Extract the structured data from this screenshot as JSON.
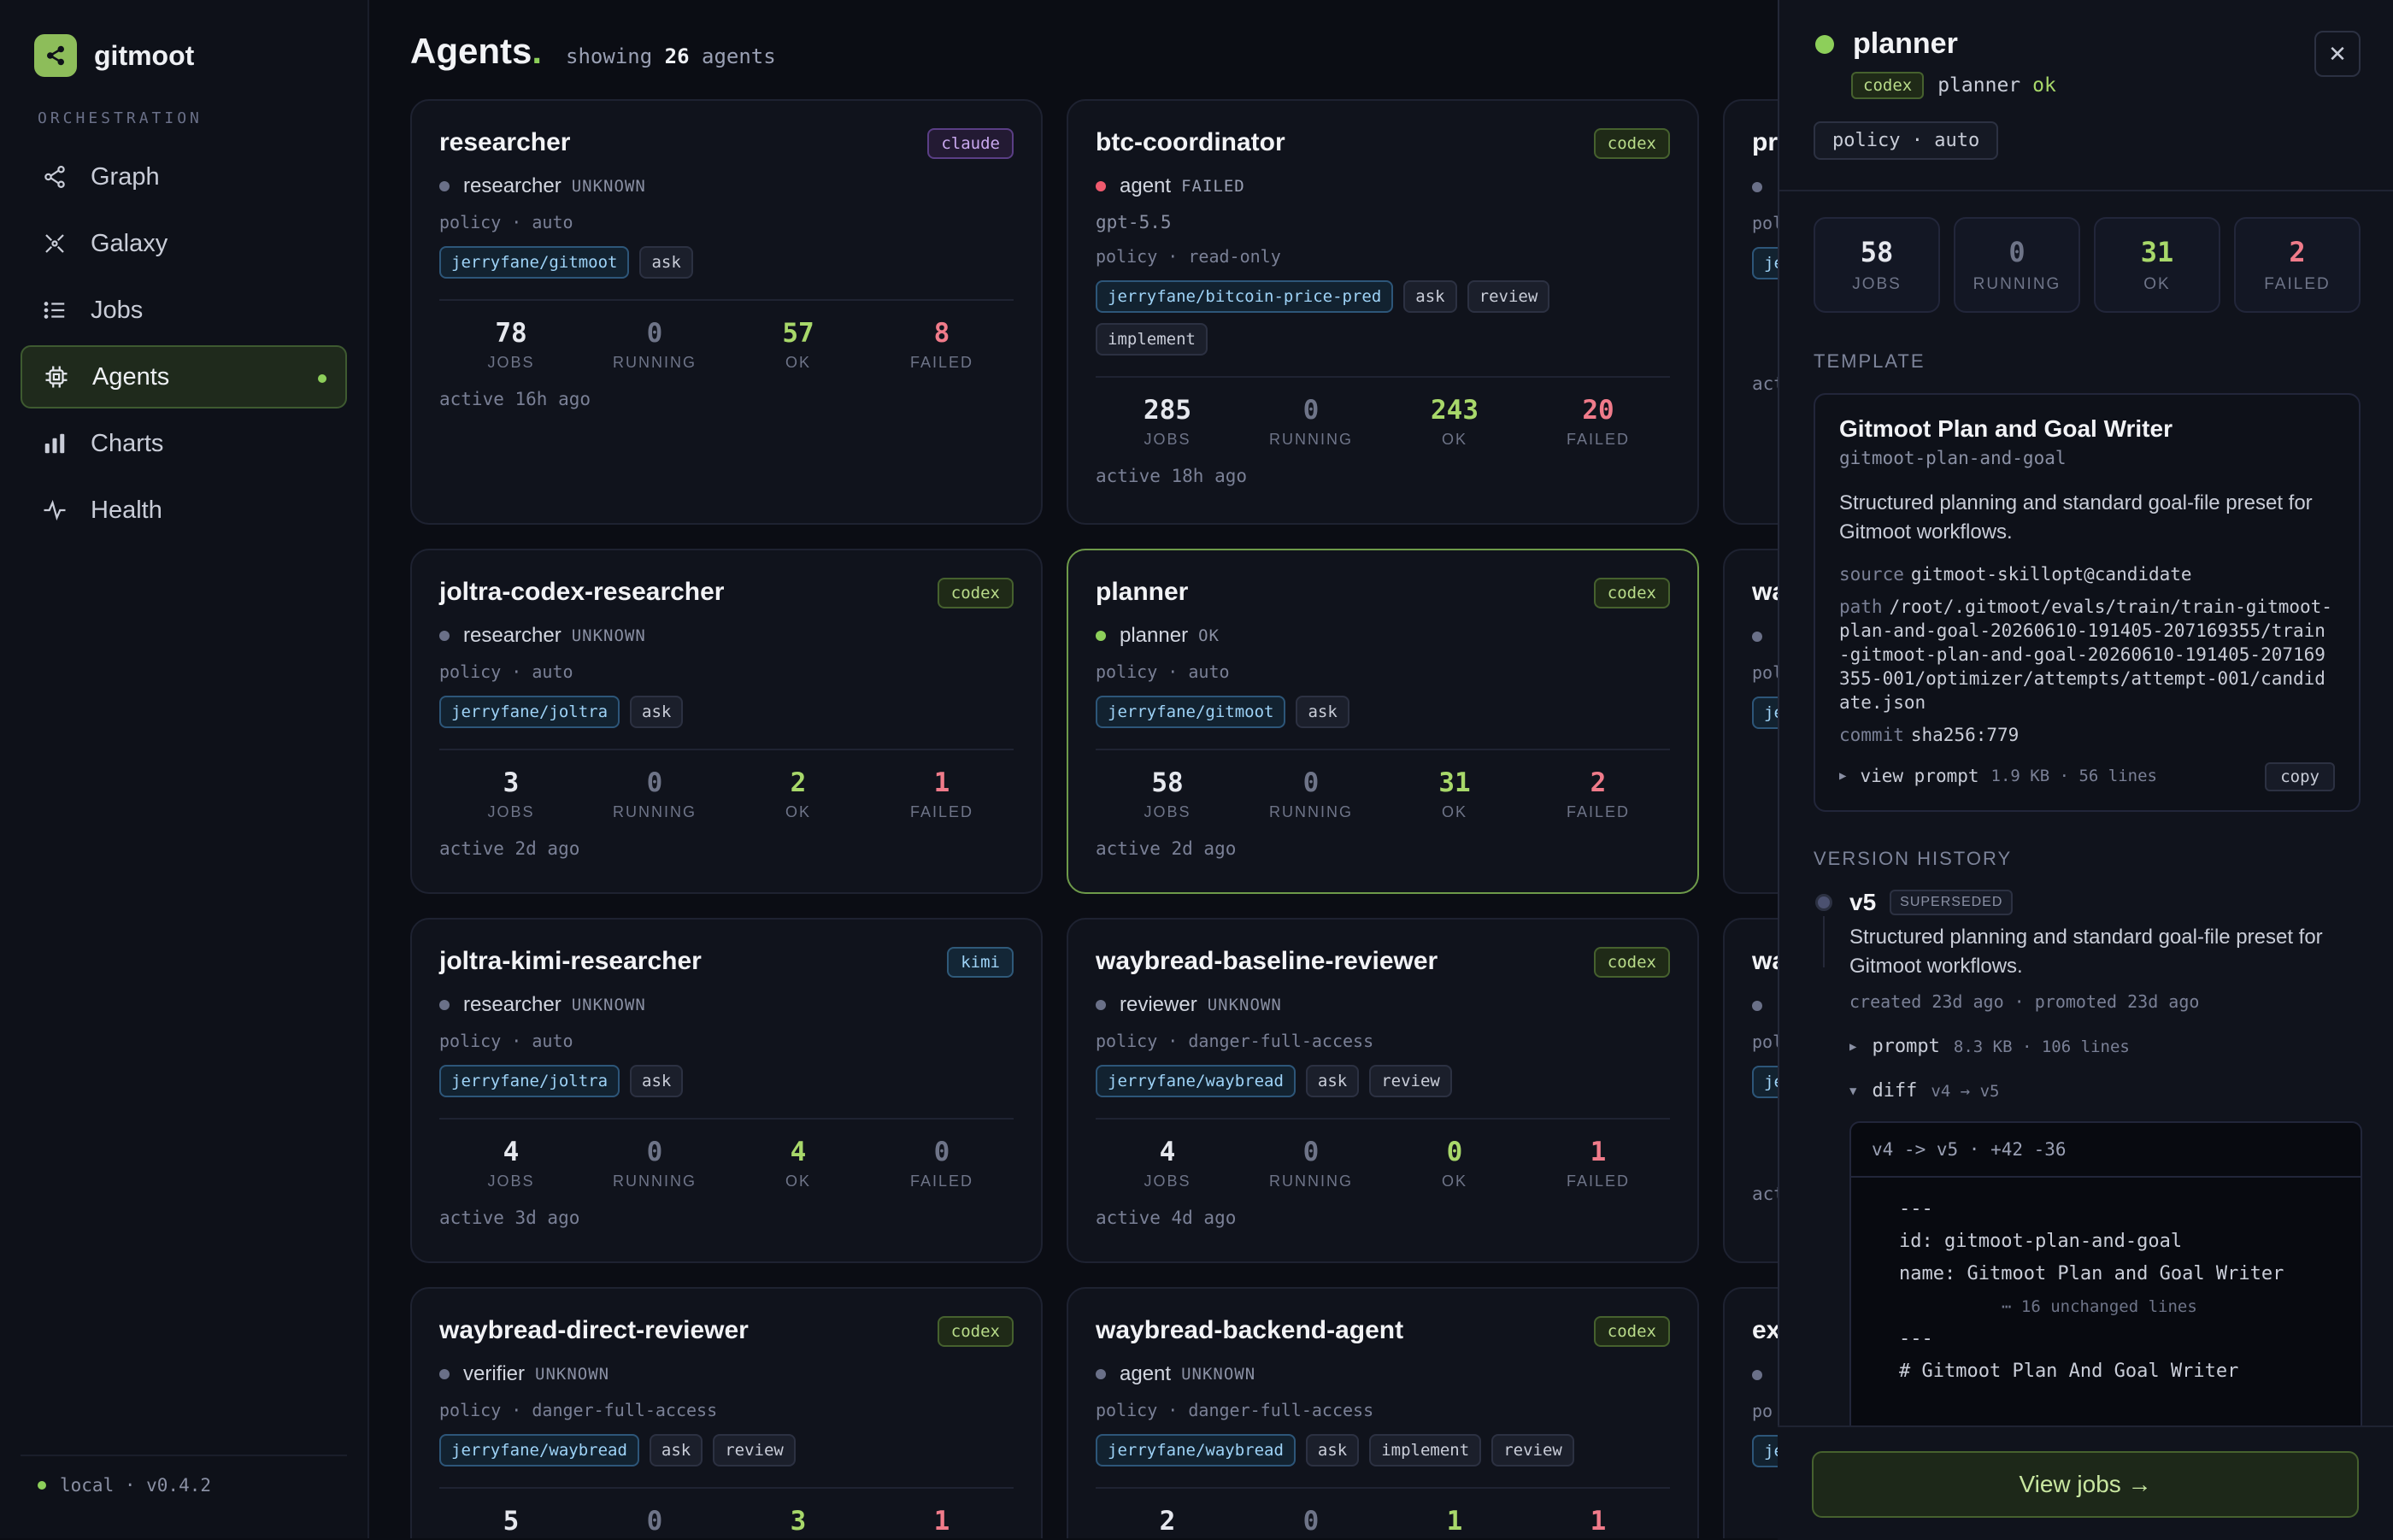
{
  "app": {
    "name": "gitmoot",
    "version_label": "local · v0.4.2"
  },
  "sidebar": {
    "section": "ORCHESTRATION",
    "items": [
      {
        "label": "Graph",
        "icon": "graph-icon",
        "active": false
      },
      {
        "label": "Galaxy",
        "icon": "galaxy-icon",
        "active": false
      },
      {
        "label": "Jobs",
        "icon": "list-icon",
        "active": false
      },
      {
        "label": "Agents",
        "icon": "chip-icon",
        "active": true
      },
      {
        "label": "Charts",
        "icon": "bar-chart-icon",
        "active": false
      },
      {
        "label": "Health",
        "icon": "pulse-icon",
        "active": false
      }
    ]
  },
  "header": {
    "title": "Agents",
    "showing_prefix": "showing",
    "count": "26",
    "showing_suffix": "agents"
  },
  "stat_labels": {
    "jobs": "JOBS",
    "running": "RUNNING",
    "ok": "OK",
    "failed": "FAILED"
  },
  "agents": [
    {
      "name": "researcher",
      "provider": "claude",
      "role": "researcher",
      "status": "UNKNOWN",
      "model": "",
      "policy": "policy · auto",
      "tags": [
        "jerryfane/gitmoot",
        "ask"
      ],
      "jobs": "78",
      "running": "0",
      "ok": "57",
      "failed": "8",
      "active": "active 16h ago"
    },
    {
      "name": "btc-coordinator",
      "provider": "codex",
      "role": "agent",
      "status": "FAILED",
      "model": "gpt-5.5",
      "policy": "policy · read-only",
      "tags": [
        "jerryfane/bitcoin-price-pred",
        "ask",
        "review",
        "implement"
      ],
      "jobs": "285",
      "running": "0",
      "ok": "243",
      "failed": "20",
      "active": "active 18h ago"
    },
    {
      "name": "pr",
      "provider": "",
      "role": "",
      "status": "",
      "model": "",
      "policy": "pol",
      "tags": [
        "je"
      ],
      "jobs": "",
      "running": "",
      "ok": "",
      "failed": "",
      "active": "act"
    },
    {
      "name": "joltra-codex-researcher",
      "provider": "codex",
      "role": "researcher",
      "status": "UNKNOWN",
      "model": "",
      "policy": "policy · auto",
      "tags": [
        "jerryfane/joltra",
        "ask"
      ],
      "jobs": "3",
      "running": "0",
      "ok": "2",
      "failed": "1",
      "active": "active 2d ago"
    },
    {
      "name": "planner",
      "provider": "codex",
      "role": "planner",
      "status": "OK",
      "model": "",
      "policy": "policy · auto",
      "tags": [
        "jerryfane/gitmoot",
        "ask"
      ],
      "jobs": "58",
      "running": "0",
      "ok": "31",
      "failed": "2",
      "active": "active 2d ago"
    },
    {
      "name": "wa",
      "provider": "",
      "role": "",
      "status": "",
      "model": "",
      "policy": "pol",
      "tags": [
        "je"
      ],
      "jobs": "",
      "running": "",
      "ok": "",
      "failed": "",
      "active": ""
    },
    {
      "name": "joltra-kimi-researcher",
      "provider": "kimi",
      "role": "researcher",
      "status": "UNKNOWN",
      "model": "",
      "policy": "policy · auto",
      "tags": [
        "jerryfane/joltra",
        "ask"
      ],
      "jobs": "4",
      "running": "0",
      "ok": "4",
      "failed": "0",
      "active": "active 3d ago"
    },
    {
      "name": "waybread-baseline-reviewer",
      "provider": "codex",
      "role": "reviewer",
      "status": "UNKNOWN",
      "model": "",
      "policy": "policy · danger-full-access",
      "tags": [
        "jerryfane/waybread",
        "ask",
        "review"
      ],
      "jobs": "4",
      "running": "0",
      "ok": "0",
      "failed": "1",
      "active": "active 4d ago"
    },
    {
      "name": "wa",
      "provider": "",
      "role": "",
      "status": "",
      "model": "",
      "policy": "pol",
      "tags": [
        "je"
      ],
      "jobs": "",
      "running": "",
      "ok": "",
      "failed": "",
      "active": "act"
    },
    {
      "name": "waybread-direct-reviewer",
      "provider": "codex",
      "role": "verifier",
      "status": "UNKNOWN",
      "model": "",
      "policy": "policy · danger-full-access",
      "tags": [
        "jerryfane/waybread",
        "ask",
        "review"
      ],
      "jobs": "5",
      "running": "0",
      "ok": "3",
      "failed": "1",
      "active": ""
    },
    {
      "name": "waybread-backend-agent",
      "provider": "codex",
      "role": "agent",
      "status": "UNKNOWN",
      "model": "",
      "policy": "policy · danger-full-access",
      "tags": [
        "jerryfane/waybread",
        "ask",
        "implement",
        "review"
      ],
      "jobs": "2",
      "running": "0",
      "ok": "1",
      "failed": "1",
      "active": ""
    },
    {
      "name": "ex",
      "provider": "",
      "role": "",
      "status": "",
      "model": "",
      "policy": "po",
      "tags": [
        "je"
      ],
      "jobs": "",
      "running": "",
      "ok": "",
      "failed": "",
      "active": ""
    }
  ],
  "detail": {
    "name": "planner",
    "provider": "codex",
    "role": "planner",
    "status": "ok",
    "policy": "policy · auto",
    "stats": {
      "jobs": "58",
      "running": "0",
      "ok": "31",
      "failed": "2"
    },
    "template_label": "TEMPLATE",
    "template": {
      "name": "Gitmoot Plan and Goal Writer",
      "id": "gitmoot-plan-and-goal",
      "description": "Structured planning and standard goal-file preset for Gitmoot workflows.",
      "source_key": "source",
      "source": "gitmoot-skillopt@candidate",
      "path_key": "path",
      "path": "/root/.gitmoot/evals/train/train-gitmoot-plan-and-goal-20260610-191405-207169355/train-gitmoot-plan-and-goal-20260610-191405-207169355-001/optimizer/attempts/attempt-001/candidate.json",
      "commit_key": "commit",
      "commit": "sha256:779",
      "view_prompt": "view prompt",
      "prompt_meta": "1.9 KB · 56 lines",
      "copy": "copy"
    },
    "history_label": "VERSION HISTORY",
    "version": {
      "ver": "v5",
      "badge": "SUPERSEDED",
      "description": "Structured planning and standard goal-file preset for Gitmoot workflows.",
      "meta": "created 23d ago · promoted 23d ago",
      "prompt_label": "prompt",
      "prompt_meta": "8.3 KB · 106 lines",
      "diff_label": "diff",
      "diff_meta": "v4 → v5"
    },
    "diff": {
      "header": "v4 -> v5 · +42 -36",
      "lines": [
        "---",
        "id: gitmoot-plan-and-goal",
        "name: Gitmoot Plan and Goal Writer"
      ],
      "unchanged": "⋯ 16 unchanged lines",
      "lines2": [
        "---",
        "# Gitmoot Plan And Goal Writer"
      ]
    },
    "view_jobs": "View jobs →"
  },
  "colors": {
    "accent": "#8dcf5a",
    "ok": "#a8d86a",
    "failed": "#f07b8a",
    "unknown": "#6a7088",
    "failed_dot": "#f05a6e"
  }
}
